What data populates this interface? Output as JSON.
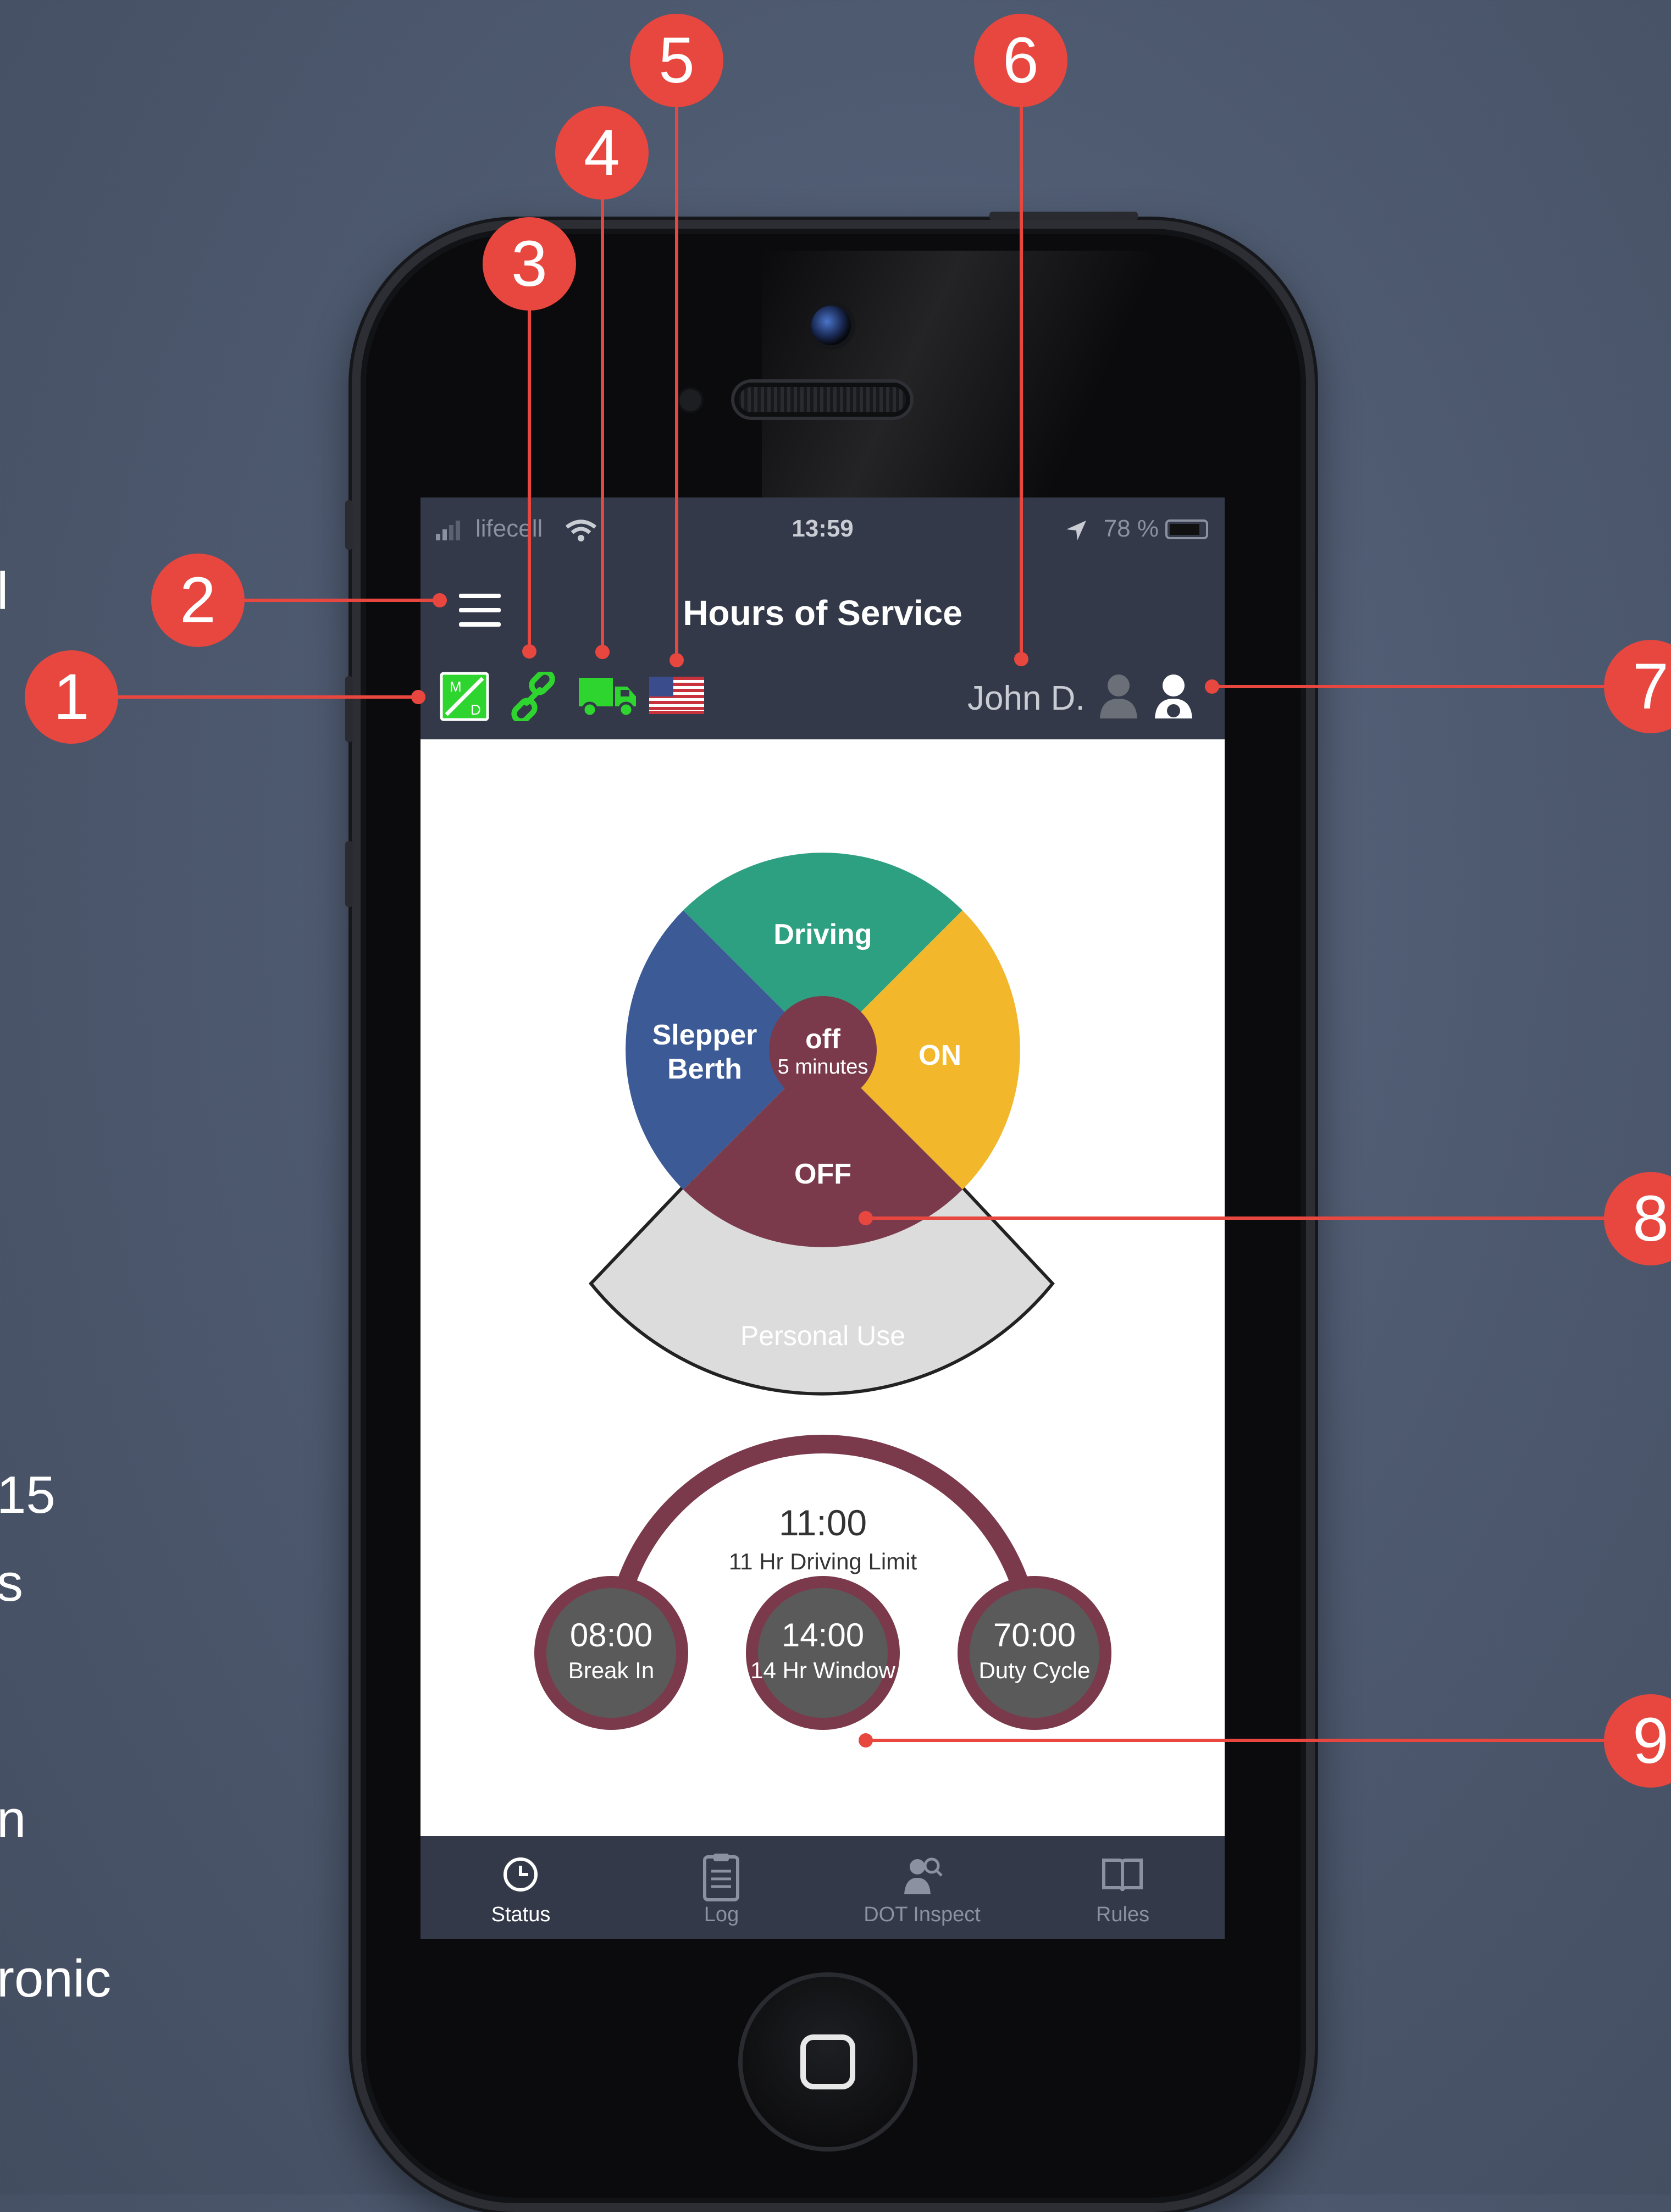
{
  "side_text": [
    "l",
    "15",
    "s",
    "n",
    "ronic"
  ],
  "status_bar": {
    "carrier": "lifecell",
    "time": "13:59",
    "battery": "78 %"
  },
  "app_bar": {
    "title": "Hours of Service"
  },
  "icon_bar": {
    "driver_name": "John D."
  },
  "duty_wheel": {
    "driving": "Driving",
    "sleeper_line1": "Slepper",
    "sleeper_line2": "Berth",
    "on": "ON",
    "off": "OFF",
    "center_status": "off",
    "center_duration": "5 minutes",
    "personal_use": "Personal Use"
  },
  "timers": {
    "driving_limit": {
      "value": "11:00",
      "label": "11 Hr Driving Limit"
    },
    "break": {
      "value": "08:00",
      "label": "Break In"
    },
    "window": {
      "value": "14:00",
      "label": "14 Hr Window"
    },
    "duty_cycle": {
      "value": "70:00",
      "label": "Duty Cycle"
    }
  },
  "tabs": [
    {
      "label": "Status",
      "icon": "clock-icon",
      "active": true
    },
    {
      "label": "Log",
      "icon": "clipboard-icon",
      "active": false
    },
    {
      "label": "DOT Inspect",
      "icon": "inspector-icon",
      "active": false
    },
    {
      "label": "Rules",
      "icon": "book-icon",
      "active": false
    }
  ],
  "callouts": [
    "1",
    "2",
    "3",
    "4",
    "5",
    "6",
    "7",
    "8",
    "9"
  ],
  "colors": {
    "driving": "#2ea082",
    "sleeper": "#3b5a96",
    "on_duty": "#f2b72b",
    "off_duty": "#7a3a4c",
    "personal_use": "#dcdcdc",
    "app_bar": "#333949",
    "callout": "#e8473f",
    "status_ok": "#2fd52f"
  }
}
